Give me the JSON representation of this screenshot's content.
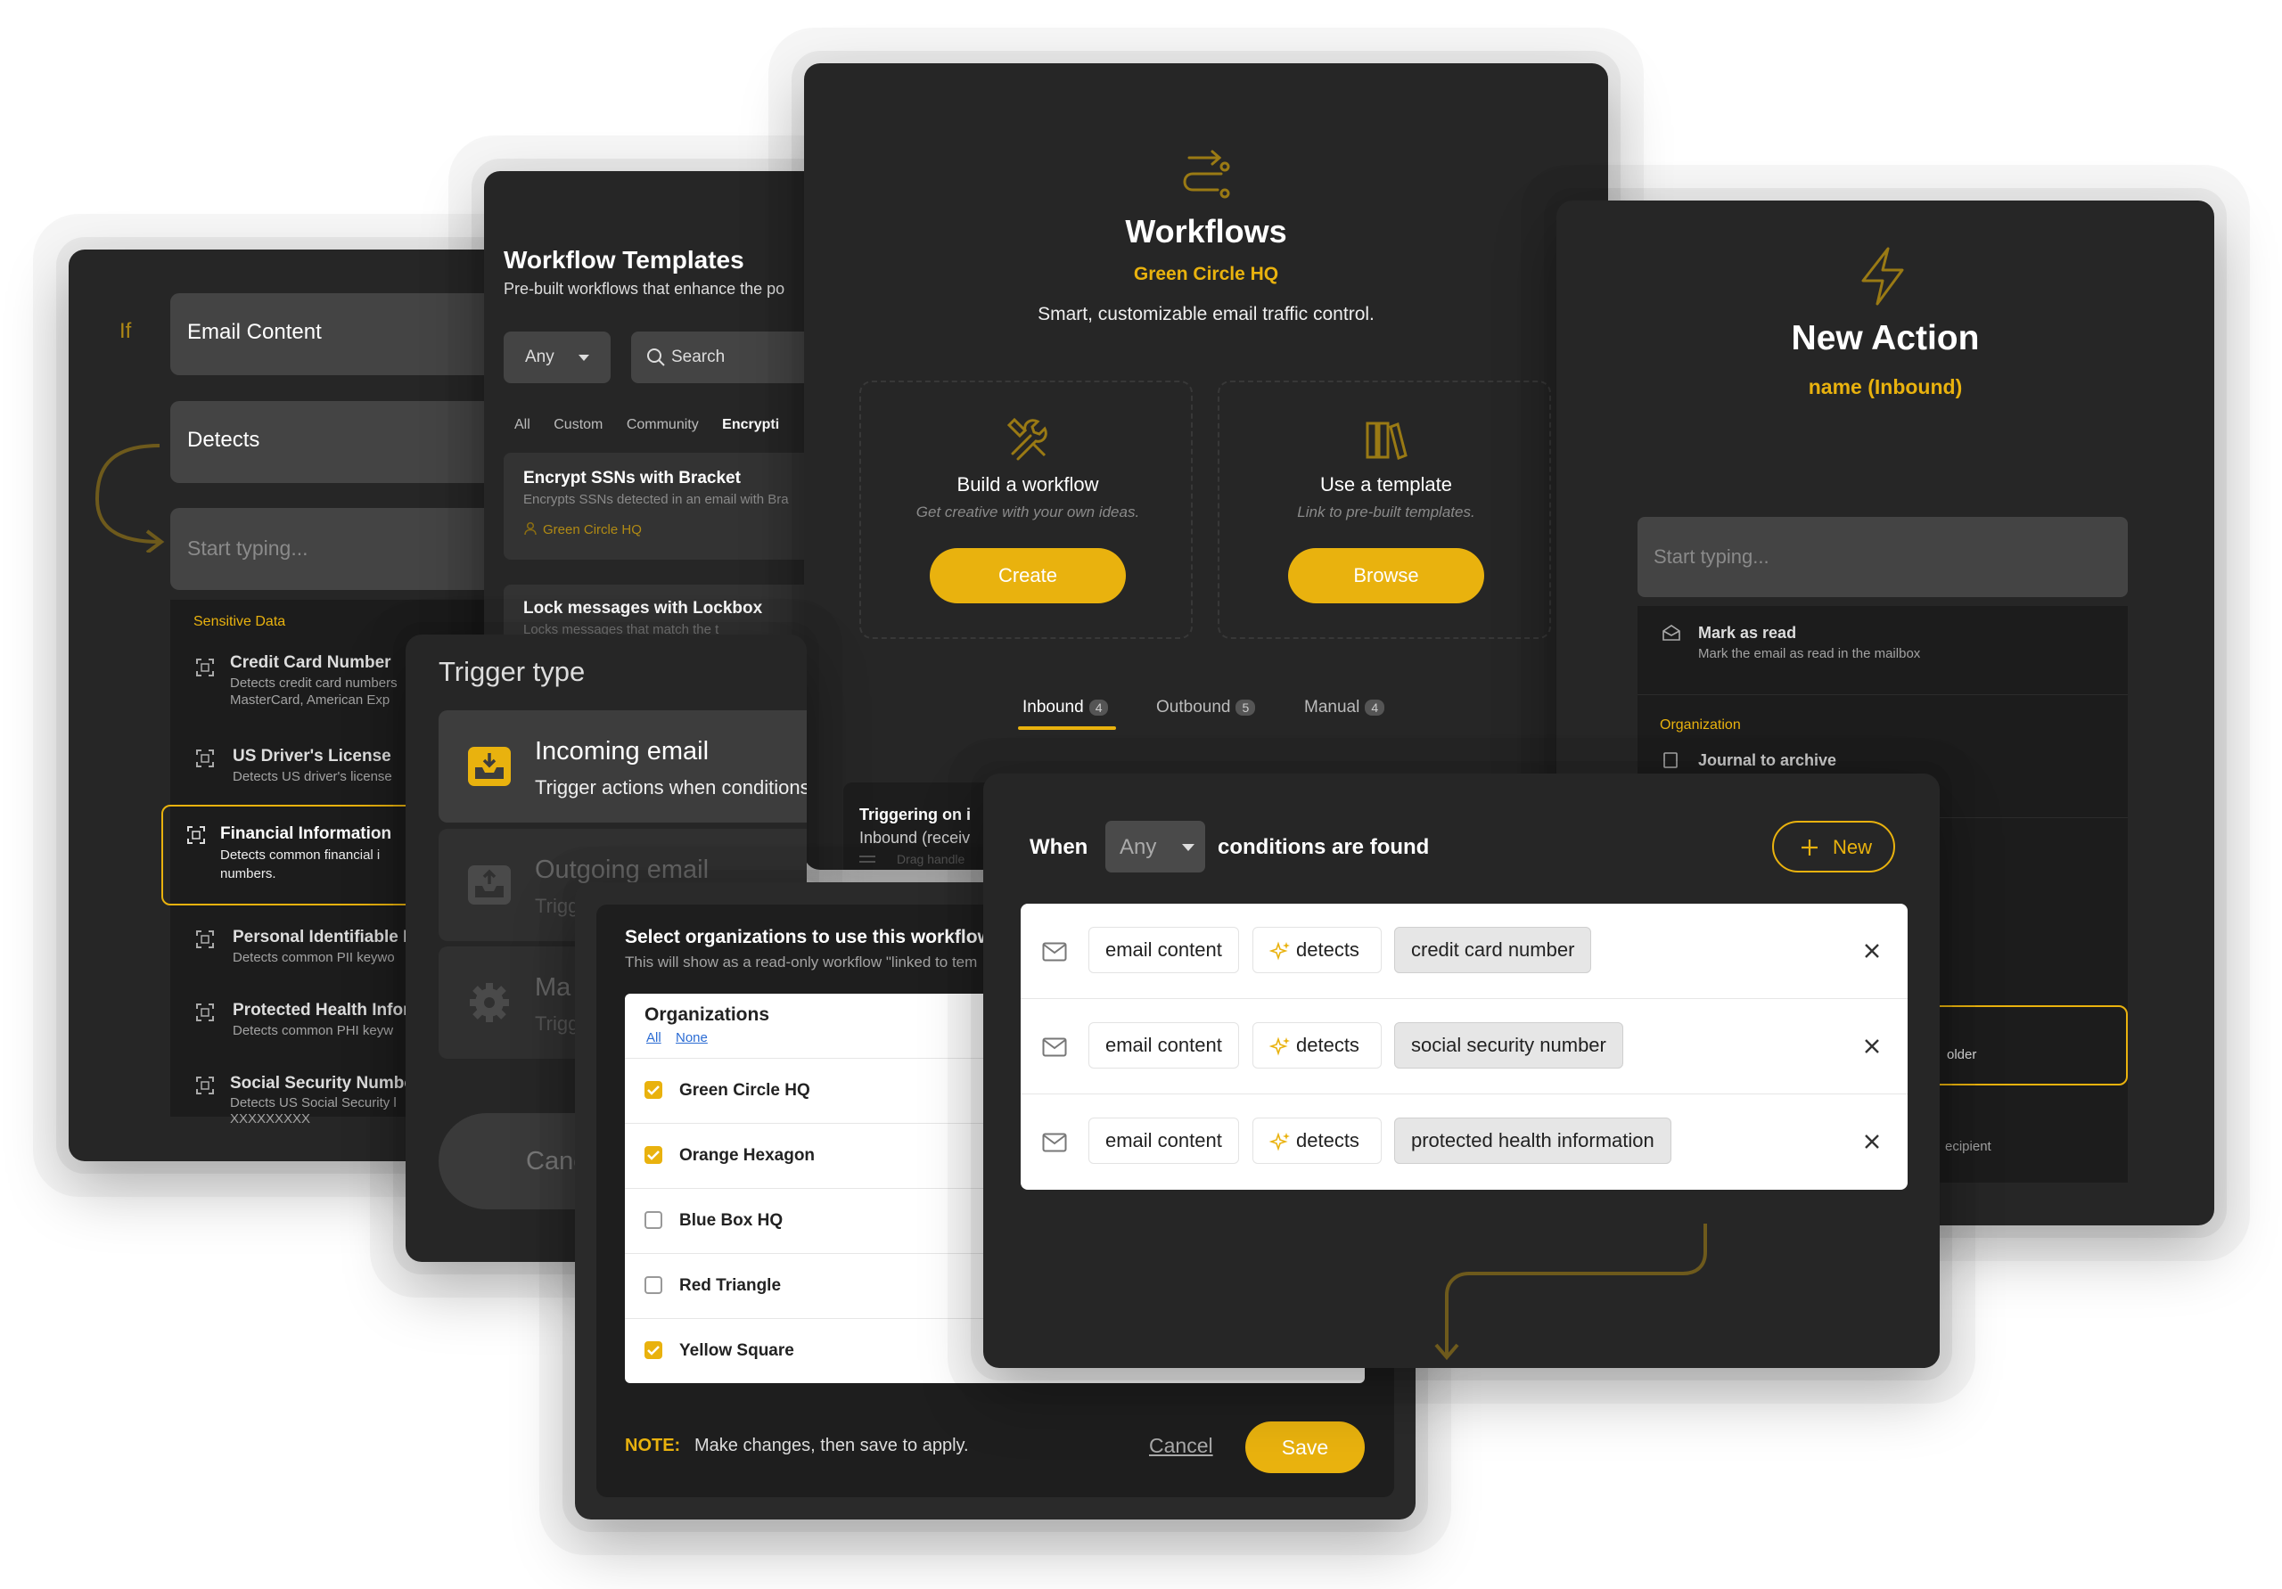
{
  "panel_conditions": {
    "if_label": "If",
    "field1": "Email Content",
    "field2": "Detects",
    "input_placeholder": "Start typing...",
    "group_label": "Sensitive Data",
    "items": [
      {
        "title": "Credit Card Number",
        "desc": "Detects credit card numbers",
        "desc2": "MasterCard, American Exp"
      },
      {
        "title": "US Driver's License",
        "desc": "Detects US driver's license"
      },
      {
        "title": "Financial Information",
        "desc": "Detects common financial i",
        "desc2": "numbers."
      },
      {
        "title": "Personal Identifiable Ir",
        "desc": "Detects common PII keywo"
      },
      {
        "title": "Protected Health Infor",
        "desc": "Detects common PHI keyw"
      },
      {
        "title": "Social Security Number",
        "desc": "Detects US Social Security l",
        "desc2": "XXXXXXXXX"
      }
    ]
  },
  "panel_templates": {
    "title": "Workflow Templates",
    "subtitle": "Pre-built workflows that enhance the po",
    "filter_value": "Any",
    "search_placeholder": "Search",
    "tabs": [
      "All",
      "Custom",
      "Community",
      "Encrypti"
    ],
    "cards": [
      {
        "title": "Encrypt SSNs with Bracket",
        "desc": "Encrypts SSNs detected in an email with Bra",
        "org": "Green Circle HQ"
      },
      {
        "title": "Lock messages with Lockbox",
        "desc": "Locks messages that match the t"
      }
    ]
  },
  "panel_workflows": {
    "title": "Workflows",
    "org": "Green Circle HQ",
    "tagline": "Smart, customizable email traffic control.",
    "build": {
      "title": "Build a workflow",
      "desc": "Get creative with your own ideas.",
      "button": "Create"
    },
    "template": {
      "title": "Use a template",
      "desc": "Link to pre-built templates.",
      "button": "Browse"
    },
    "tabs": [
      {
        "label": "Inbound",
        "count": "4"
      },
      {
        "label": "Outbound",
        "count": "5"
      },
      {
        "label": "Manual",
        "count": "4"
      }
    ],
    "list_title": "Triggering on i",
    "list_sub": "Inbound (receiv",
    "list_drag": "Drag handle"
  },
  "panel_action": {
    "title": "New Action",
    "subtitle": "name (Inbound)",
    "input_placeholder": "Start typing...",
    "item1_title": "Mark as read",
    "item1_desc": "Mark the email as read in the mailbox",
    "group_label": "Organization",
    "item2_title": "Journal to archive",
    "item3_fragment": "older",
    "item4_fragment": "ecipient"
  },
  "panel_trigger": {
    "title": "Trigger type",
    "options": [
      {
        "title": "Incoming email",
        "desc": "Trigger actions when conditions"
      },
      {
        "title": "Outgoing email",
        "desc": "Trigg"
      },
      {
        "title": "Ma",
        "desc": "Trigg"
      }
    ],
    "cancel": "Canc"
  },
  "panel_orgs": {
    "heading": "Select organizations to use this workflow t",
    "subheading": "This will show as a read-only workflow \"linked to tem",
    "box_title": "Organizations",
    "link_all": "All",
    "link_none": "None",
    "orgs": [
      {
        "name": "Green Circle HQ",
        "checked": true
      },
      {
        "name": "Orange Hexagon",
        "checked": true
      },
      {
        "name": "Blue Box HQ",
        "checked": false
      },
      {
        "name": "Red Triangle",
        "checked": false
      },
      {
        "name": "Yellow Square",
        "checked": true
      }
    ],
    "note_label": "NOTE:",
    "note_text": "Make changes, then save to apply.",
    "cancel": "Cancel",
    "save": "Save"
  },
  "panel_when": {
    "when": "When",
    "match_value": "Any",
    "suffix": "conditions are found",
    "new_button": "New",
    "rows": [
      {
        "field": "email content",
        "op": "detects",
        "value": "credit card number"
      },
      {
        "field": "email content",
        "op": "detects",
        "value": "social security number"
      },
      {
        "field": "email content",
        "op": "detects",
        "value": "protected health information"
      }
    ]
  },
  "colors": {
    "accent": "#e9b20e",
    "panel": "#262626",
    "card": "#1a1a1a"
  }
}
